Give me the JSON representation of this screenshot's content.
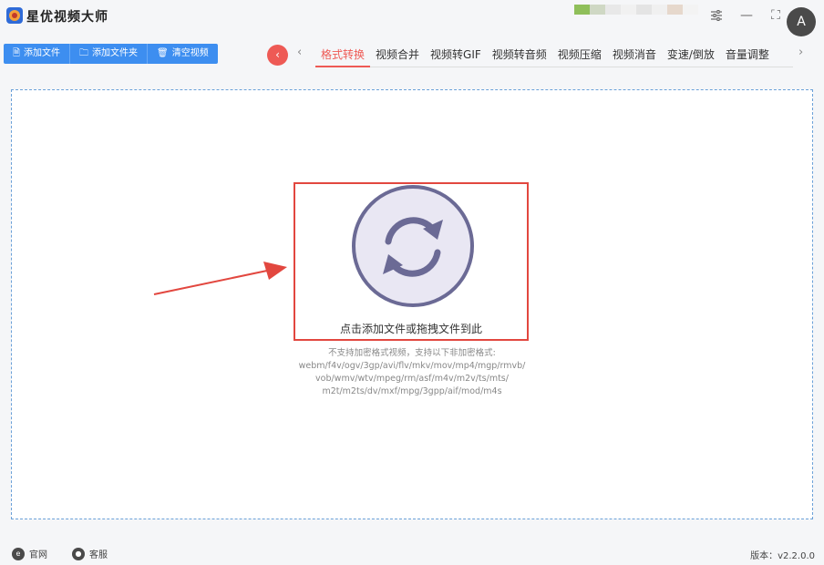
{
  "app": {
    "title": "星优视频大师",
    "logo_icon": "camera-logo-icon"
  },
  "window_controls": {
    "settings_icon": "sliders-icon",
    "minimize_glyph": "—",
    "maximize_glyph": "⛶",
    "avatar_glyph": "A"
  },
  "toolbar": {
    "add_file": "添加文件",
    "add_folder": "添加文件夹",
    "clear_videos": "清空视频"
  },
  "tabs": {
    "back_glyph": "‹",
    "prev_glyph": "‹",
    "next_glyph": "›",
    "items": [
      {
        "label": "格式转换",
        "active": true
      },
      {
        "label": "视频合并",
        "active": false
      },
      {
        "label": "视频转GIF",
        "active": false
      },
      {
        "label": "视频转音频",
        "active": false
      },
      {
        "label": "视频压缩",
        "active": false
      },
      {
        "label": "视频消音",
        "active": false
      },
      {
        "label": "变速/倒放",
        "active": false
      },
      {
        "label": "音量调整",
        "active": false
      }
    ]
  },
  "dropzone": {
    "main_label": "点击添加文件或拖拽文件到此",
    "support_line1": "不支持加密格式视频，支持以下非加密格式:",
    "support_line2": "webm/f4v/ogv/3gp/avi/flv/mkv/mov/mp4/mgp/rmvb/",
    "support_line3": "vob/wmv/wtv/mpeg/rm/asf/m4v/m2v/ts/mts/",
    "support_line4": "m2t/m2ts/dv/mxf/mpg/3gpp/aif/mod/m4s"
  },
  "statusbar": {
    "site_label": "官网",
    "service_label": "客服",
    "version": "版本：v2.2.0.0"
  },
  "colors": {
    "accent": "#ee5a55",
    "primary": "#3d8ef0",
    "highlight": "#e2473f",
    "icon_stroke": "#6b6a95"
  }
}
